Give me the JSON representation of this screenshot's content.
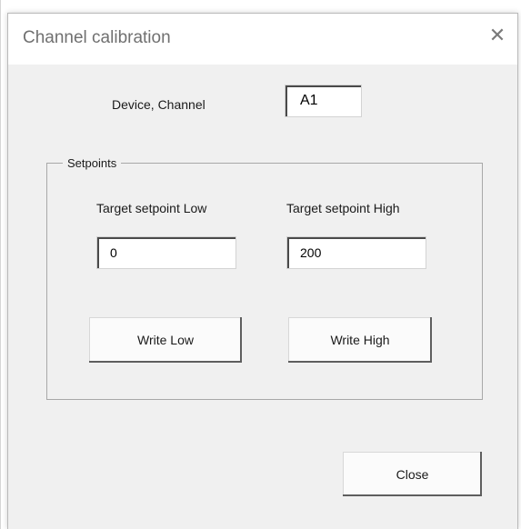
{
  "dialog": {
    "title": "Channel calibration",
    "close_icon": "close-icon"
  },
  "device_channel": {
    "label": "Device, Channel",
    "value": "A1"
  },
  "setpoints": {
    "legend": "Setpoints",
    "low": {
      "label": "Target setpoint Low",
      "value": "0",
      "button_label": "Write Low"
    },
    "high": {
      "label": "Target setpoint High",
      "value": "200",
      "button_label": "Write High"
    }
  },
  "footer": {
    "close_label": "Close"
  }
}
